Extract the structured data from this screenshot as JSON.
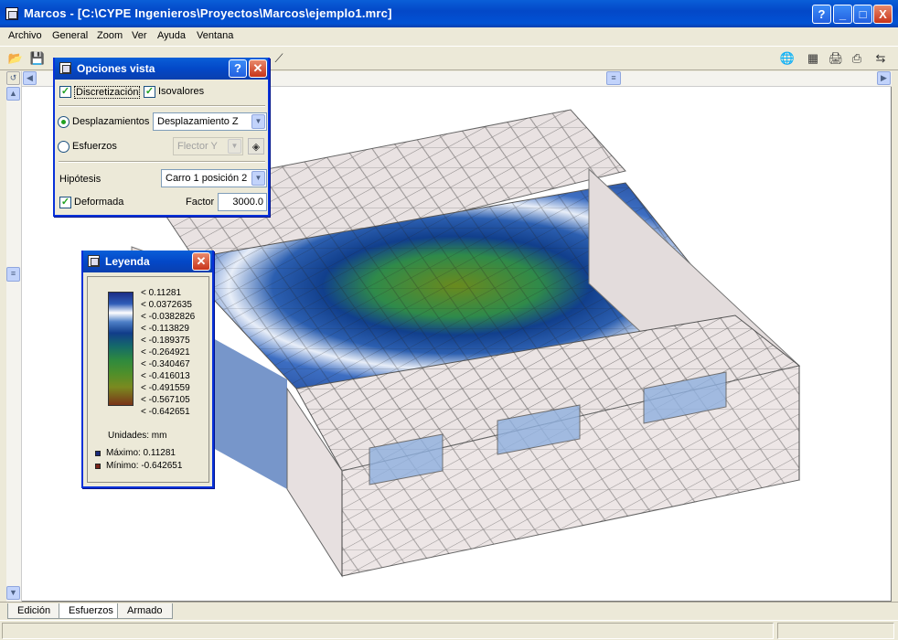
{
  "window": {
    "title": "Marcos - [C:\\CYPE Ingenieros\\Proyectos\\Marcos\\ejemplo1.mrc]",
    "buttons": [
      "?",
      "_",
      "□",
      "X"
    ]
  },
  "menu": [
    "Archivo",
    "General",
    "Zoom",
    "Ver",
    "Ayuda",
    "Ventana"
  ],
  "options_dialog": {
    "title": "Opciones vista",
    "discretizacion_label": "Discretización",
    "discretizacion_checked": true,
    "isovalores_label": "Isovalores",
    "isovalores_checked": true,
    "desplazamientos_label": "Desplazamientos",
    "desplazamientos_value": "Desplazamiento Z",
    "esfuerzos_label": "Esfuerzos",
    "esfuerzos_value": "Flector Y",
    "hipotesis_label": "Hipótesis",
    "hipotesis_value": "Carro 1 posición 2",
    "deformada_label": "Deformada",
    "deformada_checked": true,
    "factor_label": "Factor",
    "factor_value": "3000.0"
  },
  "legend": {
    "title": "Leyenda",
    "entries": [
      "< 0.11281",
      "< 0.0372635",
      "< -0.0382826",
      "< -0.113829",
      "< -0.189375",
      "< -0.264921",
      "< -0.340467",
      "< -0.416013",
      "< -0.491559",
      "< -0.567105",
      "< -0.642651"
    ],
    "units": "Unidades: mm",
    "max_label": "Máximo: 0.11281",
    "min_label": "Mínimo: -0.642651",
    "max_color": "#1a2a7a",
    "min_color": "#7a2418"
  },
  "tabs": [
    "Edición",
    "Esfuerzos",
    "Armado"
  ],
  "active_tab": "Esfuerzos"
}
